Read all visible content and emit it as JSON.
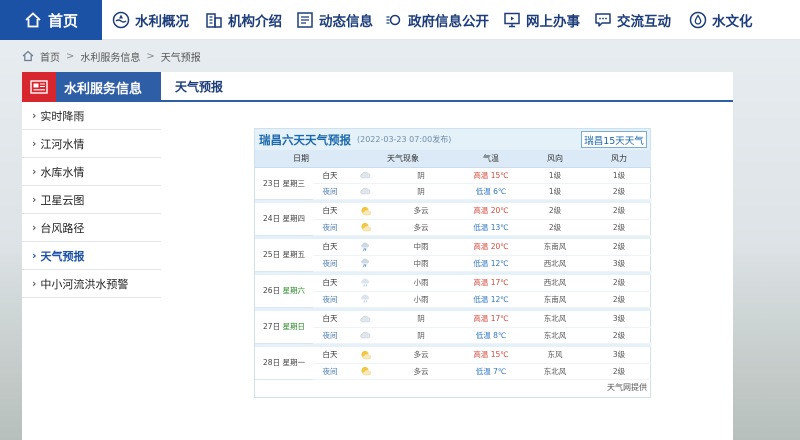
{
  "nav": {
    "home_label": "首页",
    "items": [
      {
        "label": "水利概况",
        "icon": "water-drop-ripple-icon"
      },
      {
        "label": "机构介绍",
        "icon": "building-icon"
      },
      {
        "label": "动态信息",
        "icon": "list-document-icon"
      },
      {
        "label": "政府信息公开",
        "icon": "info-open-icon"
      },
      {
        "label": "网上办事",
        "icon": "monitor-icon"
      },
      {
        "label": "交流互动",
        "icon": "chat-bubble-icon"
      },
      {
        "label": "水文化",
        "icon": "water-drop-icon"
      }
    ]
  },
  "breadcrumb": {
    "items": [
      "首页",
      "水利服务信息",
      "天气预报"
    ],
    "separator": ">"
  },
  "sidebar": {
    "title": "水利服务信息",
    "items": [
      {
        "label": "实时降雨",
        "active": false
      },
      {
        "label": "江河水情",
        "active": false
      },
      {
        "label": "水库水情",
        "active": false
      },
      {
        "label": "卫星云图",
        "active": false
      },
      {
        "label": "台风路径",
        "active": false
      },
      {
        "label": "天气预报",
        "active": true
      },
      {
        "label": "中小河流洪水预警",
        "active": false
      }
    ]
  },
  "content": {
    "tab_title": "天气预报"
  },
  "weather": {
    "title": "瑞昌六天天气预报",
    "published": "(2022-03-23 07:00发布)",
    "link_15": "瑞昌15天天气",
    "columns": {
      "date": "日期",
      "phenomenon": "天气现象",
      "temperature": "气温",
      "wind_dir": "风向",
      "wind_force": "风力"
    },
    "source": "天气网提供",
    "days": [
      {
        "date": "23日",
        "weekday": "星期三",
        "weekend": false,
        "day": {
          "period": "白天",
          "icon": "cloudy-icon",
          "cond": "阴",
          "temp_label": "高温",
          "temp": "15℃",
          "wind_dir": "1级",
          "wind": "1级"
        },
        "night": {
          "period": "夜间",
          "icon": "cloudy-icon",
          "cond": "阴",
          "temp_label": "低温",
          "temp": "6℃",
          "wind_dir": "1级",
          "wind": "2级"
        }
      },
      {
        "date": "24日",
        "weekday": "星期四",
        "weekend": false,
        "day": {
          "period": "白天",
          "icon": "partly-cloudy-icon",
          "cond": "多云",
          "temp_label": "高温",
          "temp": "20℃",
          "wind_dir": "2级",
          "wind": "2级"
        },
        "night": {
          "period": "夜间",
          "icon": "partly-cloudy-icon",
          "cond": "多云",
          "temp_label": "低温",
          "temp": "13℃",
          "wind_dir": "2级",
          "wind": "2级"
        }
      },
      {
        "date": "25日",
        "weekday": "星期五",
        "weekend": false,
        "day": {
          "period": "白天",
          "icon": "heavy-rain-icon",
          "cond": "中雨",
          "temp_label": "高温",
          "temp": "20℃",
          "wind_dir": "东南风",
          "wind": "2级"
        },
        "night": {
          "period": "夜间",
          "icon": "heavy-rain-icon",
          "cond": "中雨",
          "temp_label": "低温",
          "temp": "12℃",
          "wind_dir": "西北风",
          "wind": "3级"
        }
      },
      {
        "date": "26日",
        "weekday": "星期六",
        "weekend": true,
        "day": {
          "period": "白天",
          "icon": "light-rain-icon",
          "cond": "小雨",
          "temp_label": "高温",
          "temp": "17℃",
          "wind_dir": "西北风",
          "wind": "2级"
        },
        "night": {
          "period": "夜间",
          "icon": "light-rain-icon",
          "cond": "小雨",
          "temp_label": "低温",
          "temp": "12℃",
          "wind_dir": "东南风",
          "wind": "2级"
        }
      },
      {
        "date": "27日",
        "weekday": "星期日",
        "weekend": true,
        "day": {
          "period": "白天",
          "icon": "cloudy-icon",
          "cond": "阴",
          "temp_label": "高温",
          "temp": "17℃",
          "wind_dir": "东北风",
          "wind": "3级"
        },
        "night": {
          "period": "夜间",
          "icon": "cloudy-icon",
          "cond": "阴",
          "temp_label": "低温",
          "temp": "8℃",
          "wind_dir": "东北风",
          "wind": "2级"
        }
      },
      {
        "date": "28日",
        "weekday": "星期一",
        "weekend": false,
        "day": {
          "period": "白天",
          "icon": "partly-cloudy-icon",
          "cond": "多云",
          "temp_label": "高温",
          "temp": "15℃",
          "wind_dir": "东风",
          "wind": "3级"
        },
        "night": {
          "period": "夜间",
          "icon": "partly-cloudy-icon",
          "cond": "多云",
          "temp_label": "低温",
          "temp": "7℃",
          "wind_dir": "东北风",
          "wind": "2级"
        }
      }
    ]
  },
  "colors": {
    "nav_blue": "#1c52a6",
    "header_blue": "#2d5ea6",
    "badge_red": "#d8262e",
    "panel_title": "#1b69ad",
    "high_temp": "#d24a3a",
    "low_temp": "#2f77c4"
  }
}
